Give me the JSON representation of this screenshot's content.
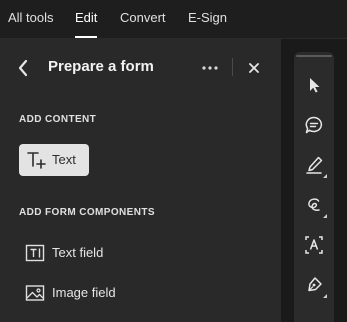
{
  "tabs": [
    {
      "label": "All tools",
      "active": false
    },
    {
      "label": "Edit",
      "active": true
    },
    {
      "label": "Convert",
      "active": false
    },
    {
      "label": "E-Sign",
      "active": false
    }
  ],
  "panel": {
    "title": "Prepare a form",
    "back_icon": "chevron-left-icon",
    "more_icon": "more-horizontal-icon",
    "close_icon": "close-icon",
    "sections": {
      "add_content": {
        "heading": "ADD CONTENT",
        "items": [
          {
            "label": "Text",
            "icon": "add-text-icon",
            "selected": true
          }
        ]
      },
      "add_form_components": {
        "heading": "ADD FORM COMPONENTS",
        "items": [
          {
            "label": "Text field",
            "icon": "text-field-icon"
          },
          {
            "label": "Image field",
            "icon": "image-field-icon"
          }
        ]
      }
    }
  },
  "toolrail": {
    "tools": [
      {
        "name": "select-tool",
        "icon": "pointer-arrow-icon"
      },
      {
        "name": "comment-tool",
        "icon": "comment-add-icon"
      },
      {
        "name": "highlight-tool",
        "icon": "highlighter-icon"
      },
      {
        "name": "draw-tool",
        "icon": "freehand-loop-icon"
      },
      {
        "name": "text-select-tool",
        "icon": "text-box-icon"
      },
      {
        "name": "sign-tool",
        "icon": "pen-sign-icon"
      }
    ]
  },
  "colors": {
    "background": "#1e1e1e",
    "panel": "#292929",
    "chip_selected": "#e3e3e3",
    "toolrail": "#2b2b2b"
  }
}
